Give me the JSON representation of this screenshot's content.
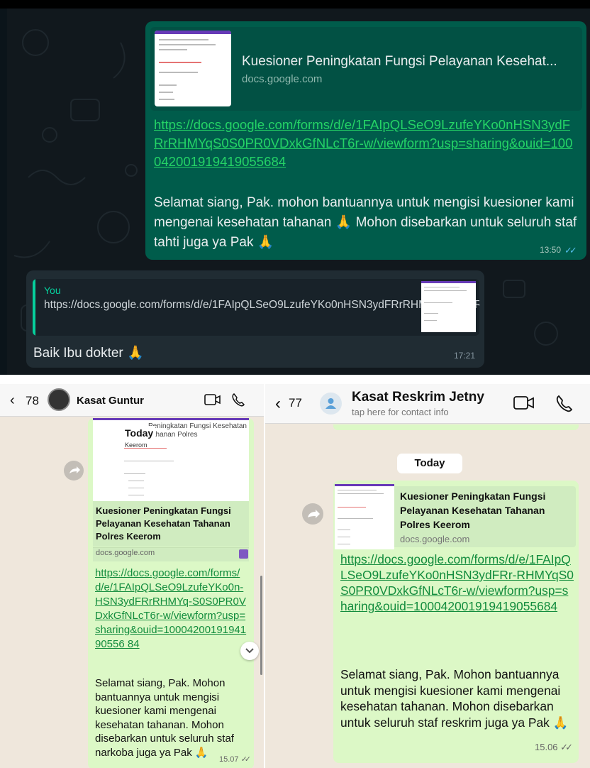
{
  "desktop_chat": {
    "outgoing": {
      "preview_title": "Kuesioner Peningkatan Fungsi Pelayanan Kesehat...",
      "preview_domain": "docs.google.com",
      "link": "https://docs.google.com/forms/d/e/1FAIpQLSeO9LzufeYKo0nHSN3ydFRrRHMYqS0S0PR0VDxkGfNLcT6r-w/viewform?usp=sharing&ouid=100042001919419055684",
      "text": "Selamat siang, Pak. mohon bantuannya untuk mengisi kuesioner kami mengenai kesehatan tahanan 🙏 Mohon disebarkan untuk seluruh staf tahti juga ya Pak 🙏",
      "time": "13:50",
      "ticks": "✓✓"
    },
    "incoming": {
      "quote_sender": "You",
      "quote_link": "https://docs.google.com/forms/d/e/1FAIpQLSeO9LzufeYKo0nHSN3ydFRrRHMYqS0S0PR0VDxkGfN...",
      "text": "Baik Ibu dokter 🙏",
      "time": "17:21"
    },
    "colors": {
      "outgoing_bg": "#005c4b",
      "incoming_bg": "#202c33",
      "link": "#24d366",
      "read_ticks": "#53bdeb"
    }
  },
  "left_phone": {
    "back_icon": "‹",
    "unread_count": "78",
    "contact_name": "Kasat Guntur",
    "thumb_today": "Today",
    "thumb_title": "Peningkatan Fungsi Kesehatan Tahanan Polres",
    "thumb_keerom": "Keerom",
    "preview_title": "Kuesioner Peningkatan Fungsi Pelayanan Kesehatan Tahanan Polres Keerom",
    "preview_domain": "docs.google.com",
    "link": "https://docs.google.com/forms/d/e/1FAIpQLSeO9LzufeYKo0n-HSN3ydFRrRHMYq-S0S0PR0VDxkGfNLcT6r-w/viewform?usp=sharing&ouid=1000420019194190556 84",
    "text": "Selamat siang, Pak. Mohon bantuannya untuk mengisi kuesioner kami mengenai kesehatan tahanan. Mohon disebarkan untuk seluruh staf narkoba juga ya Pak 🙏",
    "time": "15.07",
    "ticks": "✓✓"
  },
  "right_phone": {
    "back_icon": "‹",
    "unread_count": "77",
    "contact_name": "Kasat Reskrim Jetny",
    "contact_sub": "tap here for contact info",
    "date_chip": "Today",
    "preview_title": "Kuesioner Peningkatan Fungsi Pelayanan Kesehatan Tahanan Polres Keerom",
    "preview_domain": "docs.google.com",
    "link": "https://docs.google.com/forms/d/e/1FAIpQLSeO9LzufeYKo0nHSN3ydFRr-RHMYqS0S0PR0VDxkGfNLcT6r-w/viewform?usp=sharing&ouid=100042001919419055684",
    "text": "Selamat siang, Pak. Mohon bantuannya untuk mengisi kuesioner kami mengenai kesehatan tahanan. Mohon disebarkan untuk seluruh staf reskrim juga ya Pak 🙏",
    "time": "15.06",
    "ticks": "✓✓"
  }
}
